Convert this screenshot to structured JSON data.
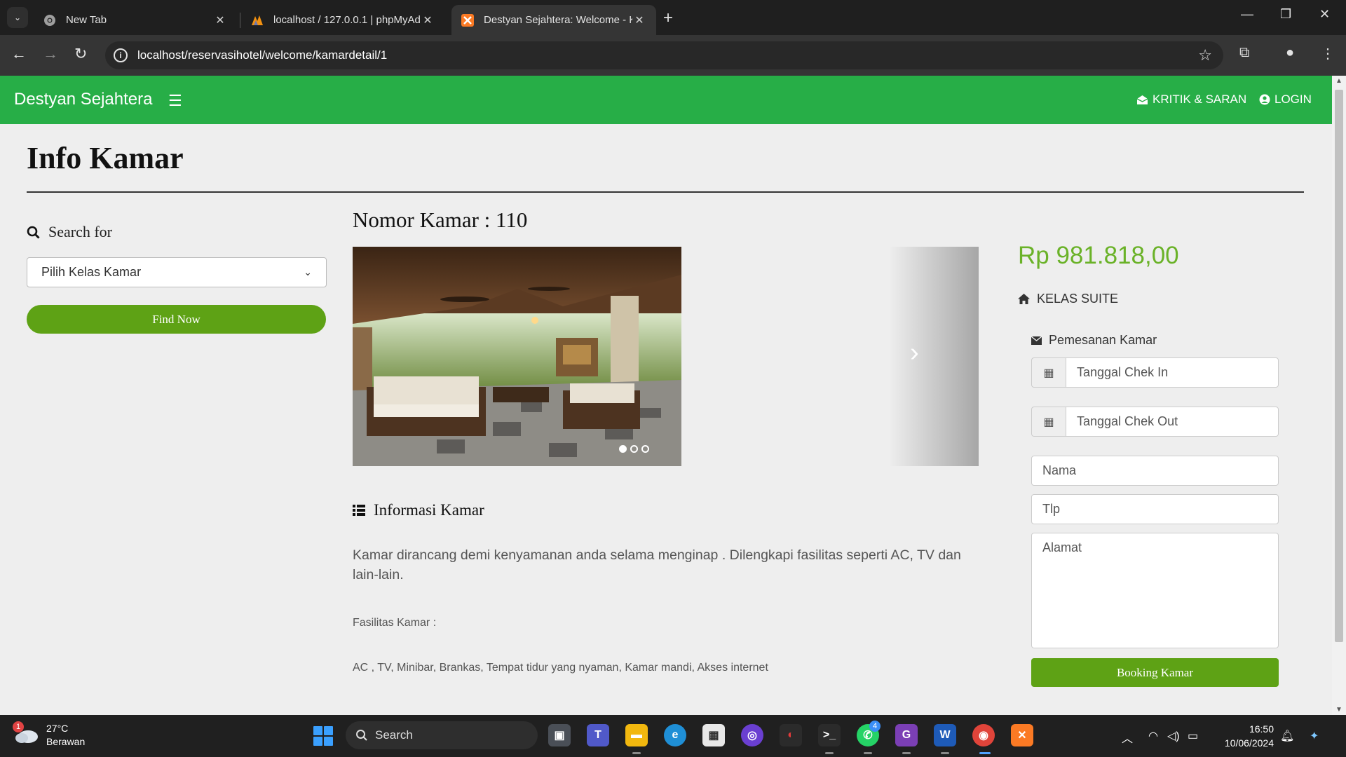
{
  "browser": {
    "tabs": [
      {
        "title": "New Tab"
      },
      {
        "title": "localhost / 127.0.0.1 | phpMyAd"
      },
      {
        "title": "Destyan Sejahtera: Welcome - K"
      }
    ],
    "url": "localhost/reservasihotel/welcome/kamardetail/1"
  },
  "site": {
    "brand": "Destyan Sejahtera",
    "nav": {
      "kritik": "KRITIK & SARAN",
      "login": "LOGIN"
    },
    "colors": {
      "navbar": "#27ae47",
      "button": "#5ea215",
      "price": "#6ab228"
    }
  },
  "page": {
    "title": "Info Kamar",
    "search": {
      "heading": "Search for",
      "select_value": "Pilih Kelas Kamar",
      "button": "Find Now"
    },
    "room": {
      "number_label": "Nomor Kamar : 110",
      "slide_indicators": {
        "count": 3,
        "active": 1
      },
      "info_heading": "Informasi Kamar",
      "description": "Kamar dirancang demi kenyamanan anda selama menginap . Dilengkapi fasilitas seperti AC, TV dan lain-lain.",
      "facilities_label": "Fasilitas Kamar :",
      "facilities": "AC , TV, Minibar, Brankas, Tempat tidur yang nyaman, Kamar mandi, Akses internet"
    },
    "booking": {
      "price": "Rp 981.818,00",
      "class": "KELAS SUITE",
      "heading": "Pemesanan Kamar",
      "checkin_placeholder": "Tanggal Chek In",
      "checkout_placeholder": "Tanggal Chek Out",
      "name_placeholder": "Nama",
      "phone_placeholder": "Tlp",
      "address_placeholder": "Alamat",
      "button": "Booking Kamar"
    }
  },
  "taskbar": {
    "weather_temp": "27°C",
    "weather_desc": "Berawan",
    "weather_badge": "1",
    "search": "Search",
    "whatsapp_badge": "4",
    "time": "16:50",
    "date": "10/06/2024"
  }
}
